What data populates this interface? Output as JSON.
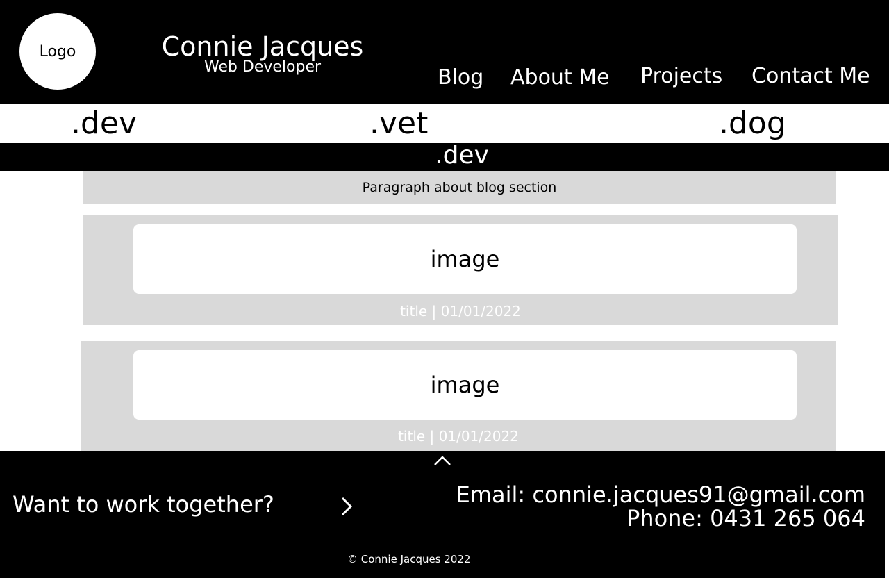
{
  "header": {
    "logo_label": "Logo",
    "name": "Connie Jacques",
    "subtitle": "Web Developer",
    "nav": [
      "Blog",
      "About Me",
      "Projects",
      "Contact Me"
    ]
  },
  "domains": {
    "options": [
      ".dev",
      ".vet",
      ".dog"
    ],
    "active": ".dev"
  },
  "blog": {
    "paragraph": "Paragraph about blog section",
    "posts": [
      {
        "image_label": "image",
        "meta": "title | 01/01/2022"
      },
      {
        "image_label": "image",
        "meta": "title | 01/01/2022"
      }
    ]
  },
  "footer": {
    "cta": "Want to work together?",
    "email": "Email: connie.jacques91@gmail.com",
    "phone": "Phone: 0431 265 064",
    "copyright": "© Connie Jacques 2022"
  },
  "colors": {
    "background": "#ffffff",
    "header": "#000000",
    "card": "#d9d9d9"
  },
  "icons": {
    "scroll_up": "chevron-up-icon",
    "cta": "chevron-right-icon"
  }
}
